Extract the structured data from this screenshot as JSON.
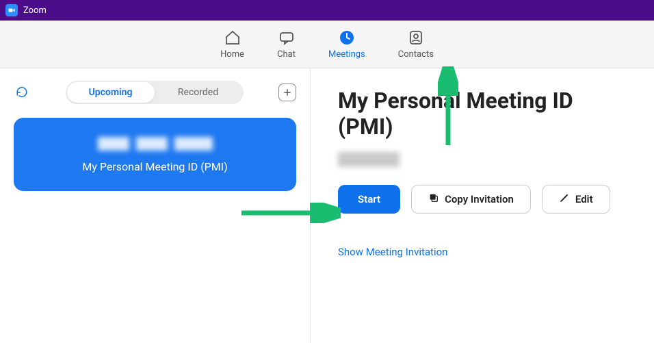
{
  "titlebar": {
    "app_name": "Zoom"
  },
  "nav": {
    "home": "Home",
    "chat": "Chat",
    "meetings": "Meetings",
    "contacts": "Contacts"
  },
  "left": {
    "upcoming": "Upcoming",
    "recorded": "Recorded",
    "card_label": "My Personal Meeting ID (PMI)"
  },
  "right": {
    "title": "My Personal Meeting ID (PMI)",
    "start": "Start",
    "copy": "Copy Invitation",
    "edit": "Edit",
    "show_invitation": "Show Meeting Invitation"
  }
}
